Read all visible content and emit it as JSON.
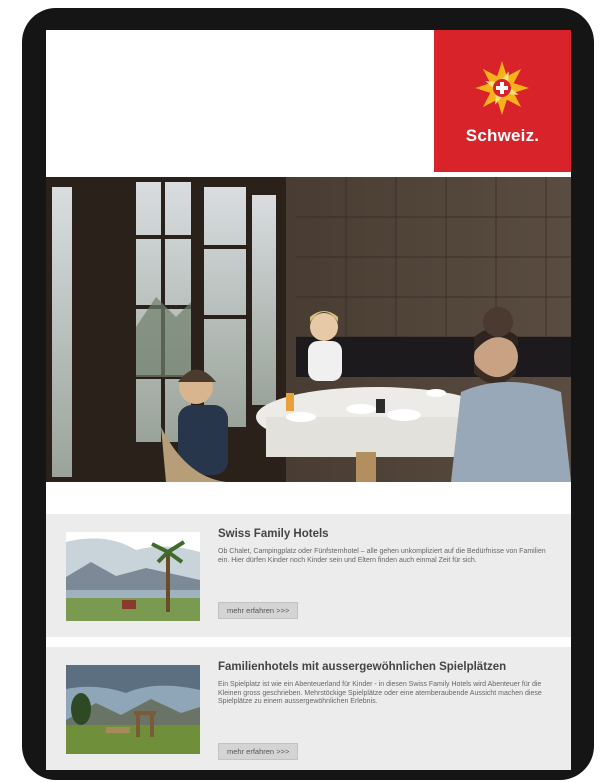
{
  "header": {
    "brand_name": "Schweiz.",
    "brand_color": "#d8232a",
    "logo_icon": "swiss-star-flower-icon"
  },
  "hero": {
    "image_description_icon": "family-breakfast-photo"
  },
  "articles": [
    {
      "title": "Swiss Family Hotels",
      "body": "Ob Chalet, Campingplatz oder Fünfsternhotel – alle gehen unkompliziert auf die Bedürfnisse von Familien ein. Hier dürfen Kinder noch Kinder sein und Eltern finden auch einmal Zeit für sich.",
      "button_label": "mehr erfahren >>>"
    },
    {
      "title": "Familienhotels mit aussergewöhnlichen Spielplätzen",
      "body": "Ein Spielplatz ist wie ein Abenteuerland für Kinder - in diesen Swiss Family Hotels wird Abenteuer für die Kleinen gross geschrieben. Mehrstöckige Spielplätze oder eine atemberaubende Aussicht machen diese Spielplätze zu einem aussergewöhnlichen Erlebnis.",
      "button_label": "mehr erfahren >>>"
    }
  ]
}
